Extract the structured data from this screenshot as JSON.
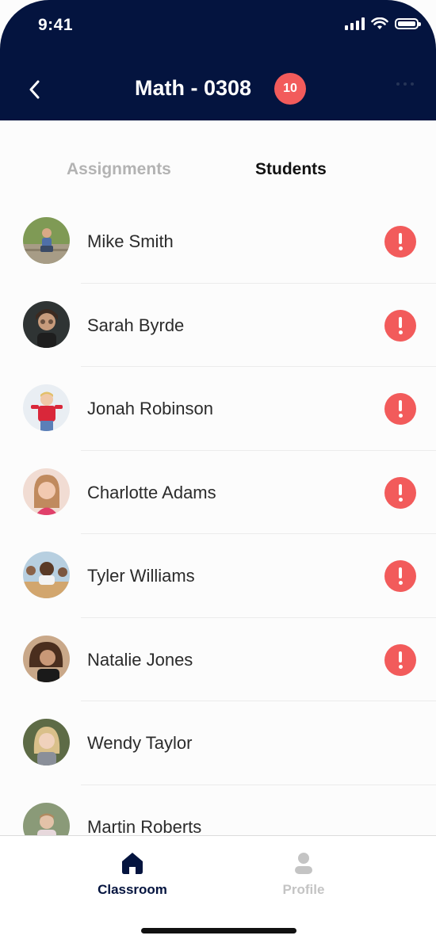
{
  "status_bar": {
    "time": "9:41"
  },
  "header": {
    "title": "Math - 0308",
    "badge_count": "10"
  },
  "tabs": [
    {
      "label": "Assignments",
      "active": false
    },
    {
      "label": "Students",
      "active": true
    }
  ],
  "students": [
    {
      "name": "Mike Smith",
      "alert": true
    },
    {
      "name": "Sarah Byrde",
      "alert": true
    },
    {
      "name": "Jonah Robinson",
      "alert": true
    },
    {
      "name": "Charlotte Adams",
      "alert": true
    },
    {
      "name": "Tyler Williams",
      "alert": true
    },
    {
      "name": "Natalie Jones",
      "alert": true
    },
    {
      "name": "Wendy Taylor",
      "alert": false
    },
    {
      "name": "Martin Roberts",
      "alert": false
    }
  ],
  "bottom_nav": [
    {
      "label": "Classroom",
      "icon": "home-icon",
      "active": true
    },
    {
      "label": "Profile",
      "icon": "user-icon",
      "active": false
    }
  ],
  "colors": {
    "header_bg": "#04143f",
    "alert": "#f25b5b",
    "inactive": "#c4c4c4"
  }
}
